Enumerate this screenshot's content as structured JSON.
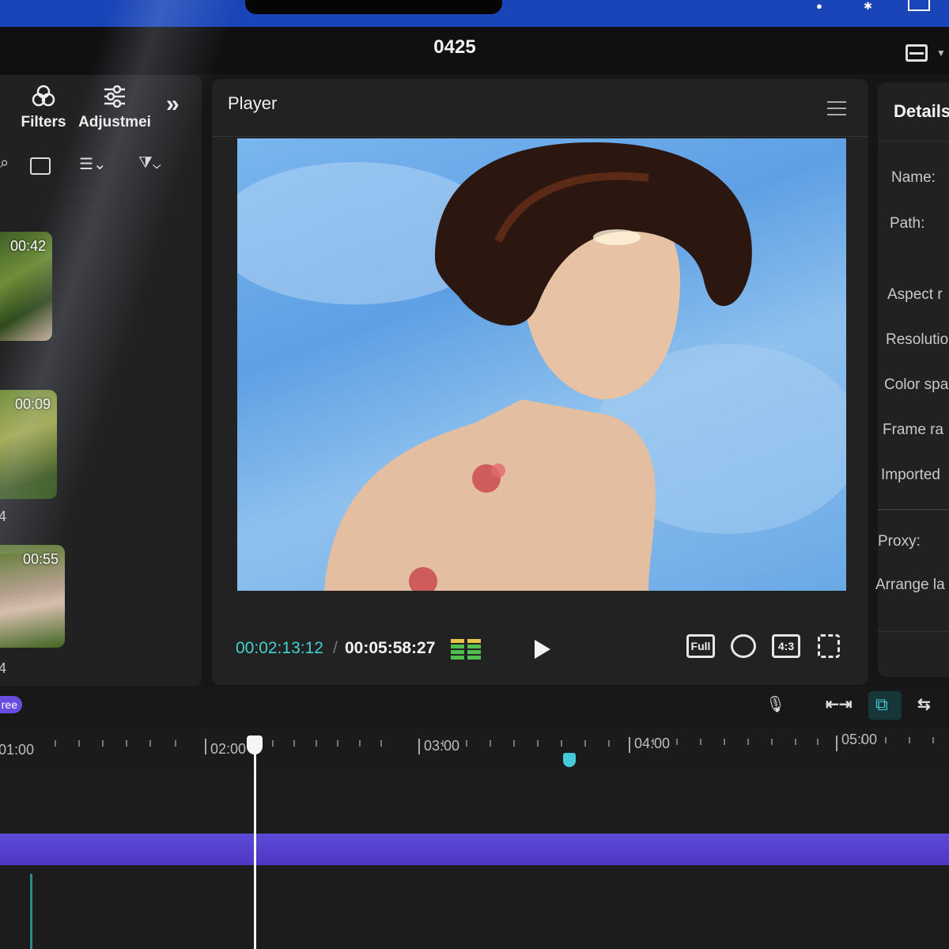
{
  "window": {
    "project_title": "0425"
  },
  "media_panel": {
    "tools": [
      {
        "label": "Filters",
        "icon": "filters-icon"
      },
      {
        "label": "Adjustmei",
        "icon": "adjustment-sliders-icon"
      }
    ],
    "more_icon": "double-chevron-right-icon",
    "toolbar_icons": [
      "search-icon",
      "grid-view-icon",
      "sort-icon",
      "filter-icon"
    ],
    "clips": [
      {
        "duration": "00:42",
        "label": ""
      },
      {
        "duration": "00:09",
        "label": "4"
      },
      {
        "duration": "00:55",
        "label": "4"
      }
    ]
  },
  "player": {
    "title": "Player",
    "current_time": "00:02:13:12",
    "separator": "/",
    "total_time": "00:05:58:27",
    "controls": {
      "full_label": "Full",
      "ratio_label": "4:3"
    },
    "icons": [
      "menu-icon",
      "audio-meter-icon",
      "play-icon",
      "full-quality-icon",
      "zoom-fit-icon",
      "aspect-ratio-icon",
      "fullscreen-icon"
    ]
  },
  "details": {
    "title": "Details",
    "labels": [
      "Name:",
      "Path:",
      "Aspect r",
      "Resolutio",
      "Color spa",
      "Frame ra",
      "Imported",
      "Proxy:",
      "Arrange la"
    ]
  },
  "timeline": {
    "badge": "ree",
    "ruler_labels": [
      "01:00",
      "02:00",
      "03:00",
      "04:00",
      "05:00"
    ],
    "icons": [
      "microphone-icon",
      "link-clips-icon",
      "snap-icon",
      "preview-axis-icon"
    ]
  },
  "colors": {
    "accent": "#41d1cf",
    "track": "#5d4ad6",
    "os_bar": "#1a45b8"
  }
}
